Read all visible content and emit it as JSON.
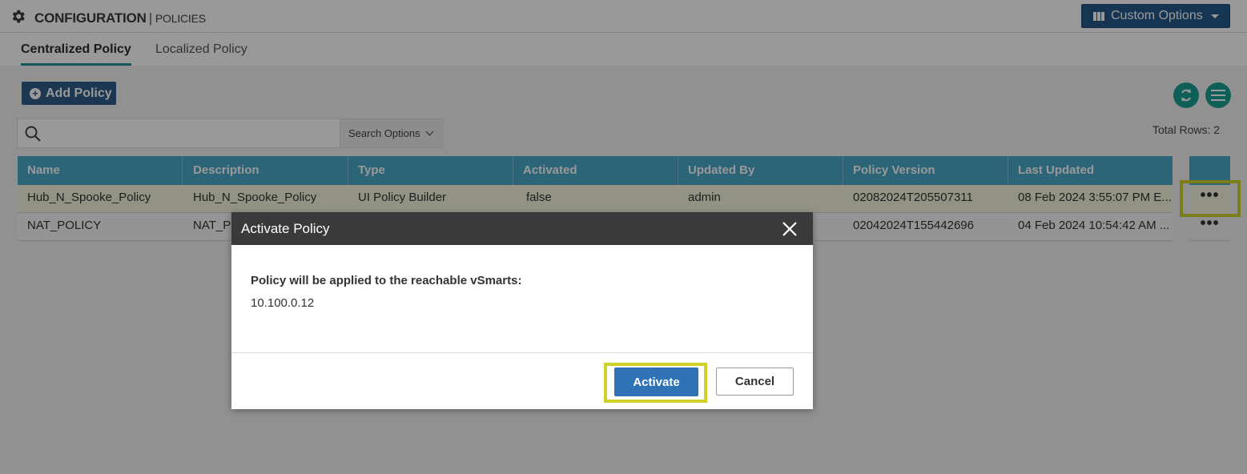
{
  "header": {
    "title": "CONFIGURATION",
    "separator": "|",
    "subtitle": "POLICIES",
    "custom_options_label": "Custom Options"
  },
  "tabs": [
    {
      "label": "Centralized Policy",
      "active": true
    },
    {
      "label": "Localized Policy",
      "active": false
    }
  ],
  "toolbar": {
    "add_policy_label": "Add Policy",
    "search_value": "",
    "search_options_label": "Search Options",
    "total_rows": "Total Rows: 2"
  },
  "table": {
    "columns": [
      "Name",
      "Description",
      "Type",
      "Activated",
      "Updated By",
      "Policy Version",
      "Last Updated"
    ],
    "rows": [
      [
        "Hub_N_Spooke_Policy",
        "Hub_N_Spooke_Policy",
        "UI Policy Builder",
        "false",
        "admin",
        "02082024T205507311",
        "08 Feb 2024 3:55:07 PM E..."
      ],
      [
        "NAT_POLICY",
        "NAT_P",
        "",
        "",
        "",
        "02042024T155442696",
        "04 Feb 2024 10:54:42 AM ..."
      ]
    ],
    "actions_label": "•••"
  },
  "modal": {
    "title": "Activate Policy",
    "message": "Policy will be applied to the reachable vSmarts:",
    "ip": "10.100.0.12",
    "activate_label": "Activate",
    "cancel_label": "Cancel"
  },
  "colors": {
    "header_button": "#24598a",
    "table_header": "#4aa7c8",
    "highlight": "#cfd12a",
    "modal_header": "#3a3a3a",
    "primary_button": "#2f72b5",
    "circle_buttons": "#1a9e94"
  }
}
